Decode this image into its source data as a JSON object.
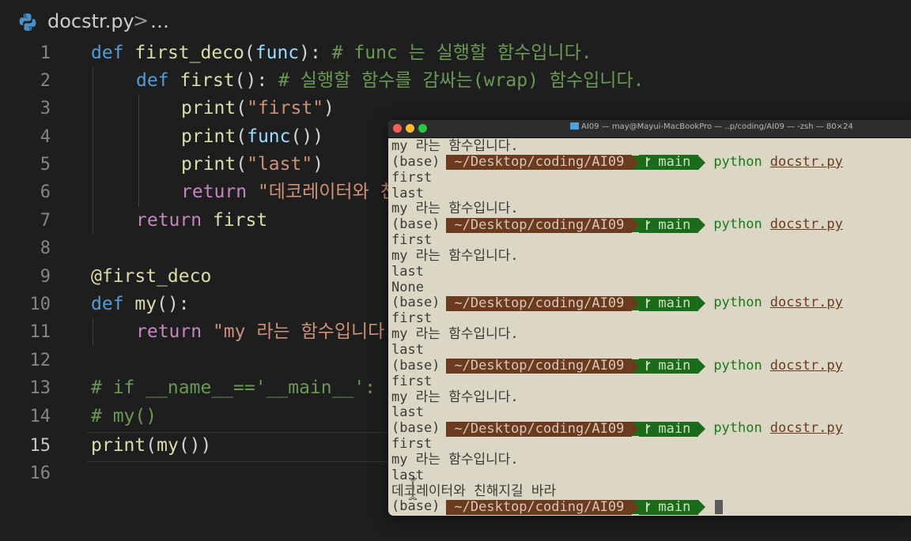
{
  "breadcrumb": {
    "file": "docstr.py",
    "separator": ">",
    "more": "…"
  },
  "editor": {
    "line_numbers": [
      "1",
      "2",
      "3",
      "4",
      "5",
      "6",
      "7",
      "8",
      "9",
      "10",
      "11",
      "12",
      "13",
      "14",
      "15",
      "16"
    ],
    "active_line": "15",
    "tokens": {
      "l1": [
        "def",
        "first_deco",
        "(",
        "func",
        "):",
        " # func 는 실행할 함수입니다."
      ],
      "l2": [
        "def",
        "first",
        "():",
        " # 실행할 함수를 감싸는(wrap) 함수입니다."
      ],
      "l3": [
        "print",
        "(",
        "\"first\"",
        ")"
      ],
      "l4": [
        "print",
        "(",
        "func",
        "())"
      ],
      "l5": [
        "print",
        "(",
        "\"last\"",
        ")"
      ],
      "l6": [
        "return",
        " \"데코레이터와 친"
      ],
      "l7": [
        "return",
        " first"
      ],
      "l9": [
        "@first_deco"
      ],
      "l10": [
        "def",
        "my",
        "():"
      ],
      "l11": [
        "return",
        " \"my 라는 함수입니다"
      ],
      "l13": [
        "# if __name__=='__main__':"
      ],
      "l14": [
        "# my()"
      ],
      "l15": [
        "print",
        "(",
        "my",
        "())"
      ]
    }
  },
  "terminal": {
    "title": "AI09 — may@Mayui-MacBookPro — ..p/coding/AI09 — -zsh — 80×24",
    "prompt": {
      "env": "(base)",
      "path": "~/Desktop/coding/AI09",
      "branch_icon": "branch-icon",
      "branch": "main"
    },
    "command": "python",
    "arg": "docstr.py",
    "lines": [
      {
        "text": "my 라는 함수입니다."
      },
      {
        "prompt": true,
        "cmd": true
      },
      {
        "text": "first"
      },
      {
        "text": "last"
      },
      {
        "text": "my 라는 함수입니다."
      },
      {
        "prompt": true,
        "cmd": true
      },
      {
        "text": "first"
      },
      {
        "text": "my 라는 함수입니다."
      },
      {
        "text": "last"
      },
      {
        "text": "None"
      },
      {
        "prompt": true,
        "cmd": true
      },
      {
        "text": "first"
      },
      {
        "text": "my 라는 함수입니다."
      },
      {
        "text": "last"
      },
      {
        "prompt": true,
        "cmd": true
      },
      {
        "text": "first"
      },
      {
        "text": "my 라는 함수입니다."
      },
      {
        "text": "last"
      },
      {
        "prompt": true,
        "cmd": true
      },
      {
        "text": "first"
      },
      {
        "text": "my 라는 함수입니다."
      },
      {
        "text": "last"
      },
      {
        "text": "데코레이터와 친해지길 바라"
      },
      {
        "prompt": true,
        "cmd": false
      }
    ]
  },
  "colors": {
    "editor_bg": "#1e1e1e",
    "terminal_bg": "#dcd7c5",
    "path_segment": "#6b3a1f",
    "git_segment": "#1a6b1a"
  }
}
